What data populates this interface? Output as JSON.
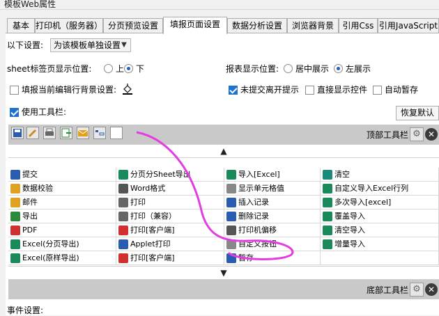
{
  "window": {
    "title": "模板Web属性"
  },
  "tabs": [
    {
      "label": "基本"
    },
    {
      "label": "打印机（服务器）"
    },
    {
      "label": "分页预览设置"
    },
    {
      "label": "填报页面设置",
      "active": true
    },
    {
      "label": "数据分析设置"
    },
    {
      "label": "浏览器背景"
    },
    {
      "label": "引用Css"
    },
    {
      "label": "引用JavaScript"
    }
  ],
  "settings": {
    "scope_label": "以下设置:",
    "scope_value": "为该模板单独设置",
    "sheet_pos_label": "sheet标签页显示位置:",
    "sheet_top": "上",
    "sheet_bottom": "下",
    "sheet_selected": "bottom",
    "report_pos_label": "报表显示位置:",
    "report_center": "居中展示",
    "report_left": "左展示",
    "report_selected": "left",
    "fill_row_bg_label": "填报当前编辑行背景设置:",
    "unsubmitted_leave_tip": "未提交离开提示",
    "direct_show_control": "直接显示控件",
    "auto_save": "自动暂存",
    "use_toolbar": "使用工具栏:",
    "restore_default": "恢复默认"
  },
  "checks": {
    "fill_row_bg": false,
    "unsubmitted_leave_tip": true,
    "direct_show_control": false,
    "auto_save": false,
    "use_toolbar": true
  },
  "top_toolbar": {
    "title": "顶部工具栏",
    "icons": [
      "save-icon",
      "pencil-icon",
      "print-icon",
      "export-icon",
      "mail-icon",
      "insert-row-icon",
      "blank-icon"
    ]
  },
  "bottom_toolbar": {
    "title": "底部工具栏"
  },
  "buttons_grid": [
    [
      {
        "label": "提交",
        "icon": "submit-icon",
        "color": "#2a5db0"
      },
      {
        "label": "分页分Sheet导出",
        "icon": "export-sheet-icon",
        "color": "#1a8a5a"
      },
      {
        "label": "导入[Excel]",
        "icon": "import-excel-icon",
        "color": "#1a8a5a"
      },
      {
        "label": "清空",
        "icon": "clear-icon",
        "color": "#1a8a7a"
      }
    ],
    [
      {
        "label": "数据校验",
        "icon": "check-data-icon",
        "color": "#e0a020"
      },
      {
        "label": "Word格式",
        "icon": "word-icon",
        "color": "#555555"
      },
      {
        "label": "显示单元格值",
        "icon": "cell-value-icon",
        "color": "#888888"
      },
      {
        "label": "自定义导入Excel行列",
        "icon": "custom-import-icon",
        "color": "#1a8a5a"
      }
    ],
    [
      {
        "label": "邮件",
        "icon": "mail-icon",
        "color": "#e0a020"
      },
      {
        "label": "打印",
        "icon": "print-icon",
        "color": "#666666"
      },
      {
        "label": "插入记录",
        "icon": "insert-record-icon",
        "color": "#2a5db0"
      },
      {
        "label": "多次导入[excel]",
        "icon": "multi-import-icon",
        "color": "#1a8a5a"
      }
    ],
    [
      {
        "label": "导出",
        "icon": "export-icon",
        "color": "#2a8a3a"
      },
      {
        "label": "打印（兼容）",
        "icon": "print-compat-icon",
        "color": "#666666"
      },
      {
        "label": "删除记录",
        "icon": "delete-record-icon",
        "color": "#2a5db0"
      },
      {
        "label": "覆盖导入",
        "icon": "overwrite-import-icon",
        "color": "#1a8a5a"
      }
    ],
    [
      {
        "label": "PDF",
        "icon": "pdf-icon",
        "color": "#d03030"
      },
      {
        "label": "打印[客户端]",
        "icon": "print-client-icon",
        "color": "#d03030"
      },
      {
        "label": "打印机偏移",
        "icon": "printer-offset-icon",
        "color": "#555555"
      },
      {
        "label": "清空导入",
        "icon": "clear-import-icon",
        "color": "#1a8a5a"
      }
    ],
    [
      {
        "label": "Excel(分页导出)",
        "icon": "excel-page-export-icon",
        "color": "#1a8a5a"
      },
      {
        "label": "Applet打印",
        "icon": "applet-print-icon",
        "color": "#2a5db0"
      },
      {
        "label": "自定义按钮",
        "icon": "custom-button-icon",
        "color": "#888888"
      },
      {
        "label": "增量导入",
        "icon": "incremental-import-icon",
        "color": "#1a8a5a"
      }
    ],
    [
      {
        "label": "Excel(原样导出)",
        "icon": "excel-original-export-icon",
        "color": "#1a8a5a"
      },
      {
        "label": "打印[客户端]",
        "icon": "print-client-icon",
        "color": "#d03030"
      },
      {
        "label": "暂存",
        "icon": "temp-save-icon",
        "color": "#2a5db0"
      },
      {
        "label": "",
        "icon": "",
        "color": ""
      }
    ]
  ],
  "footer": {
    "event_settings": "事件设置:"
  }
}
